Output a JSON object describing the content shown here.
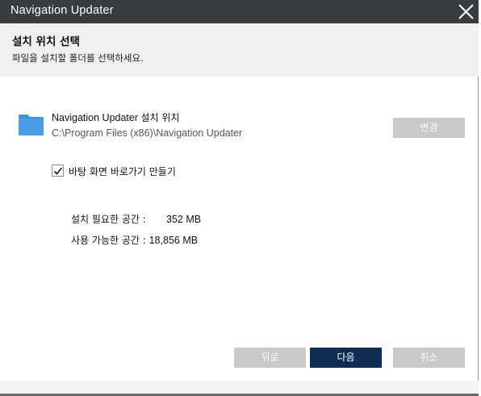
{
  "window": {
    "title": "Navigation Updater"
  },
  "header": {
    "title": "설치 위치 선택",
    "subtitle": "파일을 설치할 폴더를 선택하세요."
  },
  "location": {
    "title_app": "Navigation Updater",
    "title_suffix": "설치 위치",
    "path": "C:\\Program Files (x86)\\Navigation Updater",
    "change_label": "변경"
  },
  "shortcut": {
    "label": "바탕 화면 바로가기 만들기",
    "checked": true
  },
  "space": {
    "required_label": "설치 필요한 공간 :",
    "required_value": "352 MB",
    "available_label": "사용 가능한 공간 :",
    "available_value": "18,856 MB"
  },
  "buttons": {
    "back": "뒤로",
    "next": "다음",
    "cancel": "취소"
  },
  "colors": {
    "titlebar": "#3a3b3d",
    "header_bg": "#f0f0f0",
    "primary_button": "#0d2b53",
    "secondary_button": "#c9c9c9",
    "folder": "#4a9be8"
  }
}
